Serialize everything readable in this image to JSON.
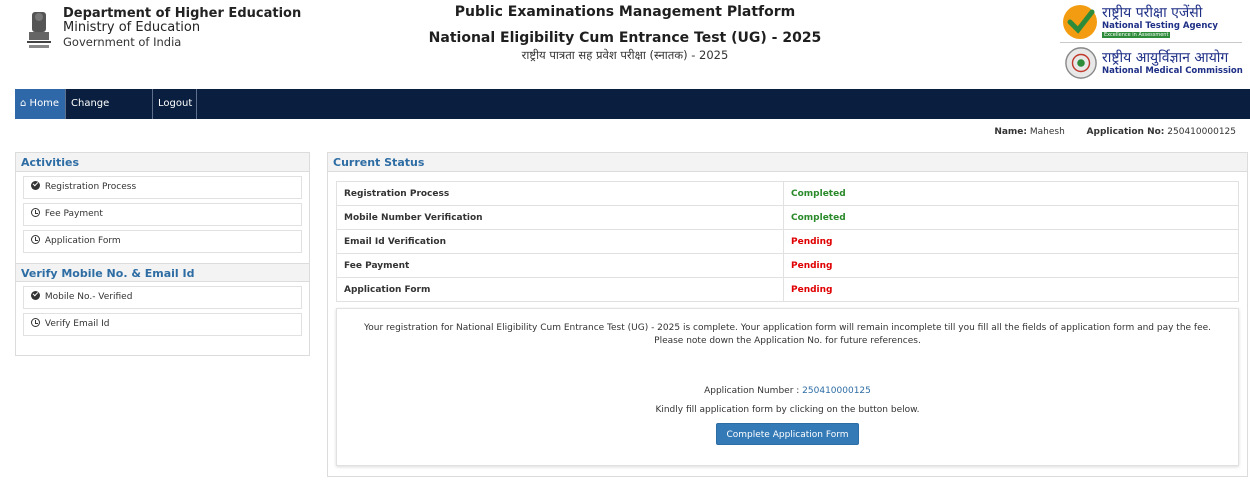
{
  "header": {
    "dept_line1": "Department of Higher Education",
    "dept_line2": "Ministry of Education",
    "dept_line3": "Government of India",
    "platform_title": "Public Examinations Management Platform",
    "exam_title": "National Eligibility Cum Entrance Test (UG) - 2025",
    "exam_title_hindi": "राष्ट्रीय पात्रता सह प्रवेश परीक्षा (स्नातक) - 2025",
    "nta_hindi": "राष्ट्रीय परीक्षा एजेंसी",
    "nta_english": "National Testing Agency",
    "nta_tagline": "Excellence in Assessment",
    "nmc_hindi": "राष्ट्रीय आयुर्विज्ञान आयोग",
    "nmc_english": "National Medical Commission"
  },
  "nav": {
    "home": "Home",
    "change_password": "Change Password",
    "logout": "Logout"
  },
  "user": {
    "name_label": "Name:",
    "name_value": "Mahesh",
    "appno_label": "Application No:",
    "appno_value": "250410000125"
  },
  "activities": {
    "title": "Activities",
    "items": [
      {
        "label": "Registration Process",
        "icon": "check-circle-icon"
      },
      {
        "label": "Fee Payment",
        "icon": "clock-icon"
      },
      {
        "label": "Application Form",
        "icon": "clock-icon"
      }
    ]
  },
  "verify": {
    "title": "Verify Mobile No. & Email Id",
    "items": [
      {
        "label": "Mobile No.- Verified",
        "icon": "check-circle-icon"
      },
      {
        "label": "Verify Email Id",
        "icon": "clock-icon"
      }
    ]
  },
  "status": {
    "title": "Current Status",
    "rows": [
      {
        "label": "Registration Process",
        "value": "Completed"
      },
      {
        "label": "Mobile Number Verification",
        "value": "Completed"
      },
      {
        "label": "Email Id Verification",
        "value": "Pending"
      },
      {
        "label": "Fee Payment",
        "value": "Pending"
      },
      {
        "label": "Application Form",
        "value": "Pending"
      }
    ]
  },
  "info": {
    "message_line1": "Your registration for National Eligibility Cum Entrance Test (UG) - 2025 is complete. Your application form will remain incomplete till you fill all the fields of application form and pay the fee.",
    "message_line2": "Please note down the Application No. for future references.",
    "appno_label": "Application Number :",
    "appno_value": "250410000125",
    "instruction": "Kindly fill application form by clicking on the button below.",
    "button_label": "Complete Application Form"
  },
  "colors": {
    "nav_bg": "#0a1f3f",
    "nav_active": "#2f68a8",
    "completed": "#2a8a2a",
    "pending": "#e00000",
    "accent": "#2e6da4"
  }
}
